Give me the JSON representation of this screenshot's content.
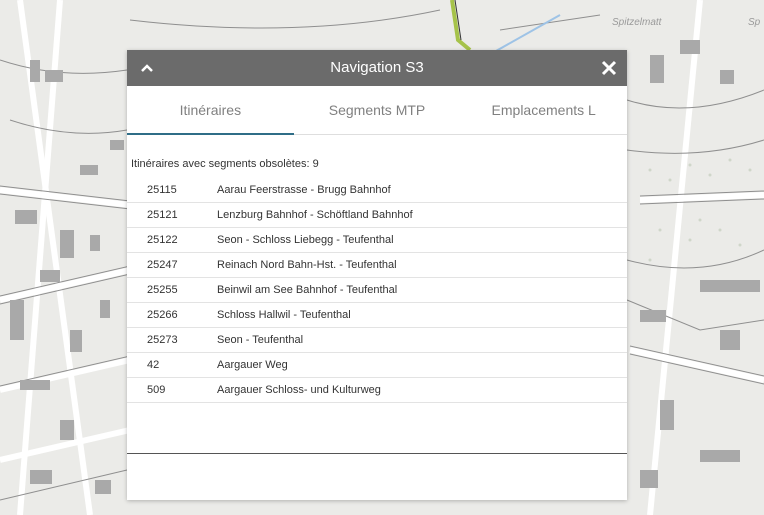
{
  "map": {
    "labels": [
      "Spitzelmatt",
      "Sp"
    ]
  },
  "panel": {
    "title": "Navigation S3",
    "collapse_icon": "chevron-up-icon",
    "close_icon": "close-icon",
    "tabs": [
      {
        "label": "Itinéraires",
        "active": true
      },
      {
        "label": "Segments MTP",
        "active": false
      },
      {
        "label": "Emplacements L",
        "active": false
      }
    ],
    "summary": "Itinéraires avec segments obsolètes: 9",
    "rows": [
      {
        "id": "25115",
        "name": "Aarau Feerstrasse - Brugg Bahnhof"
      },
      {
        "id": "25121",
        "name": "Lenzburg Bahnhof - Schöftland Bahnhof"
      },
      {
        "id": "25122",
        "name": "Seon - Schloss Liebegg - Teufenthal"
      },
      {
        "id": "25247",
        "name": "Reinach Nord Bahn-Hst. - Teufenthal"
      },
      {
        "id": "25255",
        "name": "Beinwil am See Bahnhof - Teufenthal"
      },
      {
        "id": "25266",
        "name": "Schloss Hallwil - Teufenthal"
      },
      {
        "id": "25273",
        "name": "Seon - Teufenthal"
      },
      {
        "id": "42",
        "name": "Aargauer Weg"
      },
      {
        "id": "509",
        "name": "Aargauer Schloss- und Kulturweg"
      }
    ]
  },
  "colors": {
    "titlebar": "#6b6b6b",
    "tab_active_underline": "#2f6d87"
  }
}
